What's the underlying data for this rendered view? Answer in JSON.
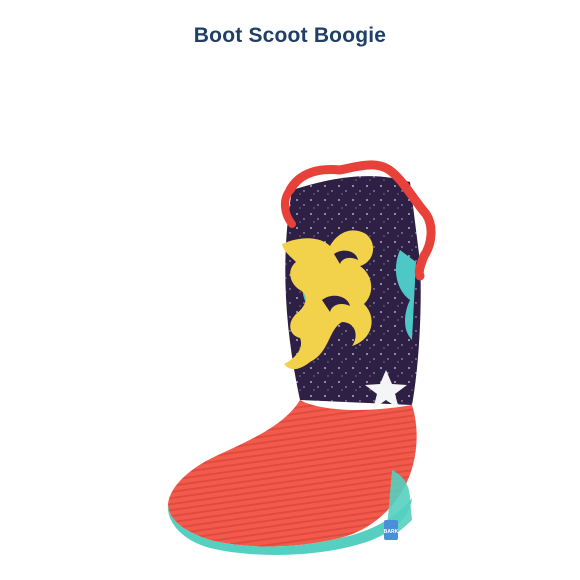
{
  "product": {
    "title": "Boot Scoot Boogie",
    "tag_text": "BARK"
  },
  "icons": {
    "boot": "cowboy-boot-toy-image",
    "star": "star-icon"
  },
  "colors": {
    "title": "#1f3f66",
    "boot_shaft": "#2e1f45",
    "corduroy": "#f25a4c",
    "sole": "#55d0c0",
    "flame_yellow": "#f2d24a",
    "flame_teal": "#4ec7c7",
    "trim_red": "#e8413a"
  }
}
